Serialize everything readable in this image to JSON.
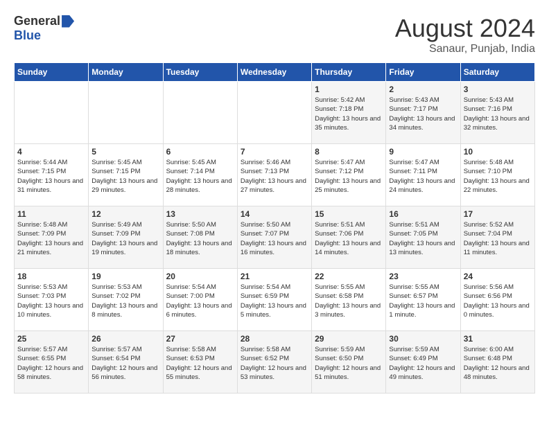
{
  "header": {
    "logo_general": "General",
    "logo_blue": "Blue",
    "month_year": "August 2024",
    "location": "Sanaur, Punjab, India"
  },
  "days_of_week": [
    "Sunday",
    "Monday",
    "Tuesday",
    "Wednesday",
    "Thursday",
    "Friday",
    "Saturday"
  ],
  "weeks": [
    [
      {
        "day": "",
        "info": ""
      },
      {
        "day": "",
        "info": ""
      },
      {
        "day": "",
        "info": ""
      },
      {
        "day": "",
        "info": ""
      },
      {
        "day": "1",
        "info": "Sunrise: 5:42 AM\nSunset: 7:18 PM\nDaylight: 13 hours\nand 35 minutes."
      },
      {
        "day": "2",
        "info": "Sunrise: 5:43 AM\nSunset: 7:17 PM\nDaylight: 13 hours\nand 34 minutes."
      },
      {
        "day": "3",
        "info": "Sunrise: 5:43 AM\nSunset: 7:16 PM\nDaylight: 13 hours\nand 32 minutes."
      }
    ],
    [
      {
        "day": "4",
        "info": "Sunrise: 5:44 AM\nSunset: 7:15 PM\nDaylight: 13 hours\nand 31 minutes."
      },
      {
        "day": "5",
        "info": "Sunrise: 5:45 AM\nSunset: 7:15 PM\nDaylight: 13 hours\nand 29 minutes."
      },
      {
        "day": "6",
        "info": "Sunrise: 5:45 AM\nSunset: 7:14 PM\nDaylight: 13 hours\nand 28 minutes."
      },
      {
        "day": "7",
        "info": "Sunrise: 5:46 AM\nSunset: 7:13 PM\nDaylight: 13 hours\nand 27 minutes."
      },
      {
        "day": "8",
        "info": "Sunrise: 5:47 AM\nSunset: 7:12 PM\nDaylight: 13 hours\nand 25 minutes."
      },
      {
        "day": "9",
        "info": "Sunrise: 5:47 AM\nSunset: 7:11 PM\nDaylight: 13 hours\nand 24 minutes."
      },
      {
        "day": "10",
        "info": "Sunrise: 5:48 AM\nSunset: 7:10 PM\nDaylight: 13 hours\nand 22 minutes."
      }
    ],
    [
      {
        "day": "11",
        "info": "Sunrise: 5:48 AM\nSunset: 7:09 PM\nDaylight: 13 hours\nand 21 minutes."
      },
      {
        "day": "12",
        "info": "Sunrise: 5:49 AM\nSunset: 7:09 PM\nDaylight: 13 hours\nand 19 minutes."
      },
      {
        "day": "13",
        "info": "Sunrise: 5:50 AM\nSunset: 7:08 PM\nDaylight: 13 hours\nand 18 minutes."
      },
      {
        "day": "14",
        "info": "Sunrise: 5:50 AM\nSunset: 7:07 PM\nDaylight: 13 hours\nand 16 minutes."
      },
      {
        "day": "15",
        "info": "Sunrise: 5:51 AM\nSunset: 7:06 PM\nDaylight: 13 hours\nand 14 minutes."
      },
      {
        "day": "16",
        "info": "Sunrise: 5:51 AM\nSunset: 7:05 PM\nDaylight: 13 hours\nand 13 minutes."
      },
      {
        "day": "17",
        "info": "Sunrise: 5:52 AM\nSunset: 7:04 PM\nDaylight: 13 hours\nand 11 minutes."
      }
    ],
    [
      {
        "day": "18",
        "info": "Sunrise: 5:53 AM\nSunset: 7:03 PM\nDaylight: 13 hours\nand 10 minutes."
      },
      {
        "day": "19",
        "info": "Sunrise: 5:53 AM\nSunset: 7:02 PM\nDaylight: 13 hours\nand 8 minutes."
      },
      {
        "day": "20",
        "info": "Sunrise: 5:54 AM\nSunset: 7:00 PM\nDaylight: 13 hours\nand 6 minutes."
      },
      {
        "day": "21",
        "info": "Sunrise: 5:54 AM\nSunset: 6:59 PM\nDaylight: 13 hours\nand 5 minutes."
      },
      {
        "day": "22",
        "info": "Sunrise: 5:55 AM\nSunset: 6:58 PM\nDaylight: 13 hours\nand 3 minutes."
      },
      {
        "day": "23",
        "info": "Sunrise: 5:55 AM\nSunset: 6:57 PM\nDaylight: 13 hours\nand 1 minute."
      },
      {
        "day": "24",
        "info": "Sunrise: 5:56 AM\nSunset: 6:56 PM\nDaylight: 13 hours\nand 0 minutes."
      }
    ],
    [
      {
        "day": "25",
        "info": "Sunrise: 5:57 AM\nSunset: 6:55 PM\nDaylight: 12 hours\nand 58 minutes."
      },
      {
        "day": "26",
        "info": "Sunrise: 5:57 AM\nSunset: 6:54 PM\nDaylight: 12 hours\nand 56 minutes."
      },
      {
        "day": "27",
        "info": "Sunrise: 5:58 AM\nSunset: 6:53 PM\nDaylight: 12 hours\nand 55 minutes."
      },
      {
        "day": "28",
        "info": "Sunrise: 5:58 AM\nSunset: 6:52 PM\nDaylight: 12 hours\nand 53 minutes."
      },
      {
        "day": "29",
        "info": "Sunrise: 5:59 AM\nSunset: 6:50 PM\nDaylight: 12 hours\nand 51 minutes."
      },
      {
        "day": "30",
        "info": "Sunrise: 5:59 AM\nSunset: 6:49 PM\nDaylight: 12 hours\nand 49 minutes."
      },
      {
        "day": "31",
        "info": "Sunrise: 6:00 AM\nSunset: 6:48 PM\nDaylight: 12 hours\nand 48 minutes."
      }
    ]
  ]
}
